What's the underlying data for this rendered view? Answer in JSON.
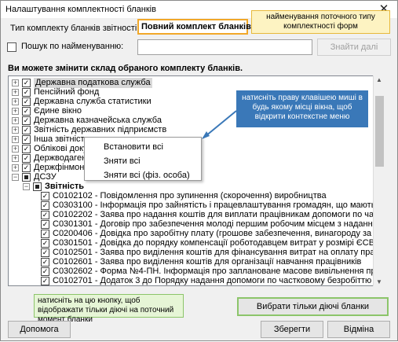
{
  "window": {
    "title": "Налаштування комплектності бланків"
  },
  "type_label": "Тип комплекту бланків звітності:",
  "type_value": "Повний комплект бланків",
  "callout_top": "найменування поточного типу комплектності форм",
  "search": {
    "label": "Пошук по найменуванню:",
    "value": "",
    "button": "Знайти далі"
  },
  "instruction": "Ви можете змінити склад обраного комплекту бланків.",
  "callout_right": "натисніть праву клавішею миші в будь якому місці вікна, щоб відкрити контекстне меню",
  "tree": [
    {
      "text": "Державна податкова служба",
      "checked": true,
      "expander": "+",
      "level": 0
    },
    {
      "text": "Пенсійний фонд",
      "checked": true,
      "expander": "+",
      "level": 0
    },
    {
      "text": "Державна служба статистики",
      "checked": true,
      "expander": "+",
      "level": 0
    },
    {
      "text": "Єдине вікно",
      "checked": true,
      "expander": "+",
      "level": 0
    },
    {
      "text": "Державна казначейська служба",
      "checked": true,
      "expander": "+",
      "level": 0
    },
    {
      "text": "Звітність державних підприємств",
      "checked": true,
      "expander": "+",
      "level": 0
    },
    {
      "text": "Інша звітність",
      "checked": true,
      "expander": "+",
      "level": 0
    },
    {
      "text": "Облікові документи",
      "checked": true,
      "expander": "+",
      "level": 0
    },
    {
      "text": "Держводагентство",
      "checked": true,
      "expander": "+",
      "level": 0
    },
    {
      "text": "Держфінмоніторинг",
      "checked": true,
      "expander": "+",
      "level": 0
    },
    {
      "text": "ДСЗУ",
      "checked": "partial",
      "expander": "−",
      "level": 0
    },
    {
      "text": "Звітність",
      "checked": "partial",
      "expander": "−",
      "level": 1,
      "bold": true
    },
    {
      "text": "C0102102 - Повідомлення про зупинення (скорочення) виробництва",
      "checked": true,
      "level": 2
    },
    {
      "text": "C0303100 - Інформація про зайнятість і працевлаштування громадян, що мають дс",
      "checked": true,
      "level": 2
    },
    {
      "text": "C0102202 - Заява про надання коштів для виплати працівникам допомоги по частк",
      "checked": true,
      "level": 2
    },
    {
      "text": "C0301301 - Договір про забезпечення молоді першим робочим місцем з наданням п",
      "checked": true,
      "level": 2
    },
    {
      "text": "C0200406 - Довідка про заробітну плату (грошове забезпечення, винагороду за ци",
      "checked": true,
      "level": 2
    },
    {
      "text": "C0301501 - Довідка до порядку компенсації роботодавцем витрат у розмірі ЄСВ",
      "checked": true,
      "level": 2
    },
    {
      "text": "C0102501 - Заява про виділення коштів для фінансування витрат на оплату праці",
      "checked": true,
      "level": 2
    },
    {
      "text": "C0102601 - Заява про виділення коштів для організації навчання працівників",
      "checked": true,
      "level": 2
    },
    {
      "text": "C0302602 - Форма №4-ПН. Інформація про заплановане масове вивільнення праці",
      "checked": true,
      "level": 2
    },
    {
      "text": "C0102701 - Додаток 3 до Порядку надання допомоги по частковому безробіттю",
      "checked": true,
      "level": 2
    }
  ],
  "context_menu": [
    "Встановити всі",
    "Зняти всі",
    "Зняти всі (фіз. особа)"
  ],
  "callout_bottom": "натисніть на цю кнопку, щоб відображати тільки діючі на поточний момент бланки",
  "buttons": {
    "active_only": "Вибрати тільки діючі бланки",
    "help": "Допомога",
    "save": "Зберегти",
    "cancel": "Відміна"
  },
  "colors": {
    "orange_border": "#f1a82a",
    "callout_blue": "#3a78b8",
    "callout_green_border": "#8cc56a"
  }
}
